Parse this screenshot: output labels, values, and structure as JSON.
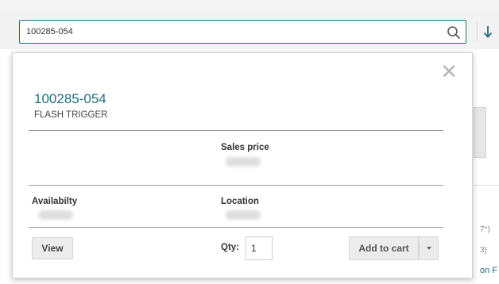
{
  "search": {
    "value": "100285-054"
  },
  "popup": {
    "product_code": "100285-054",
    "product_name": "FLASH TRIGGER",
    "sales_price_label": "Sales price",
    "availability_label": "Availabilty",
    "location_label": "Location",
    "view_label": "View",
    "qty_label": "Qty:",
    "qty_value": "1",
    "add_to_cart_label": "Add to cart"
  },
  "background": {
    "text_1": "7*)",
    "text_2": "3)",
    "link_text": "on F"
  },
  "colors": {
    "accent": "#1f6f7d",
    "button_bg": "#ececec"
  },
  "icons": [
    "search-icon",
    "sort-down-icon",
    "close-icon",
    "caret-down-icon"
  ]
}
